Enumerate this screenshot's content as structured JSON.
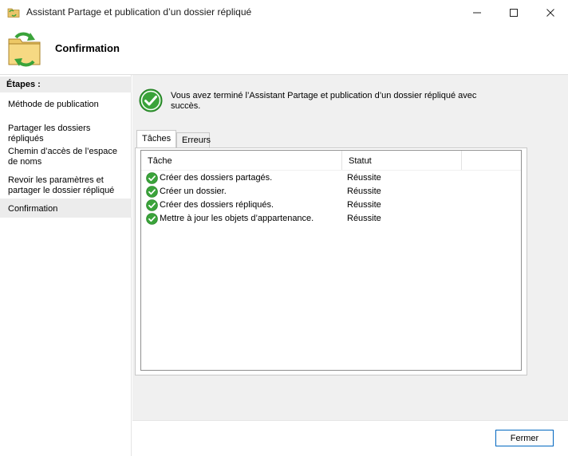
{
  "window": {
    "title": "Assistant Partage et publication d’un dossier répliqué"
  },
  "header": {
    "title": "Confirmation"
  },
  "sidebar": {
    "heading": "Étapes :",
    "items": [
      {
        "label": "Méthode de publication"
      },
      {
        "label": "Partager les dossiers répliqués"
      },
      {
        "label": "Chemin d’accès de l’espace de noms"
      },
      {
        "label": "Revoir les paramètres et partager le dossier répliqué"
      },
      {
        "label": "Confirmation"
      }
    ],
    "active_index": 4
  },
  "main": {
    "message": "Vous avez terminé l’Assistant Partage et publication d’un dossier répliqué avec succès.",
    "tabs": [
      {
        "label": "Tâches"
      },
      {
        "label": "Erreurs"
      }
    ],
    "active_tab": 0,
    "table": {
      "columns": [
        "Tâche",
        "Statut"
      ],
      "rows": [
        {
          "task": "Créer des dossiers partagés.",
          "status": "Réussite"
        },
        {
          "task": "Créer un dossier.",
          "status": "Réussite"
        },
        {
          "task": "Créer des dossiers répliqués.",
          "status": "Réussite"
        },
        {
          "task": "Mettre à jour les objets d’appartenance.",
          "status": "Réussite"
        }
      ]
    }
  },
  "footer": {
    "close_label": "Fermer"
  },
  "icons": {
    "app": "folder-share-icon",
    "header": "folder-sync-icon",
    "success": "check-circle-icon",
    "row_status": "check-circle-icon",
    "minimize": "minimize-icon",
    "maximize": "maximize-icon",
    "close": "close-icon"
  },
  "colors": {
    "success_green": "#3aa33a",
    "accent_blue": "#0067c0",
    "panel_gray": "#f0f0f0",
    "active_step_bg": "#ececec"
  }
}
